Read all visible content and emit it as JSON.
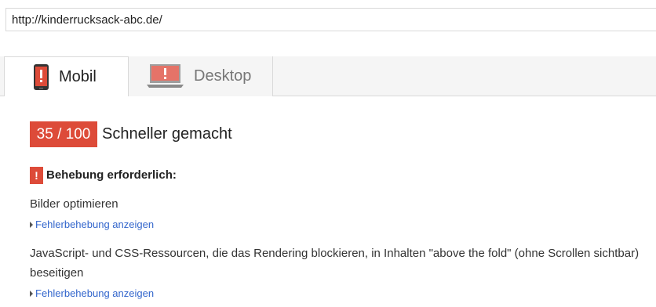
{
  "url_bar": {
    "value": "http://kinderrucksack-abc.de/"
  },
  "tabs": [
    {
      "label": "Mobil",
      "icon": "phone-icon",
      "selected": true
    },
    {
      "label": "Desktop",
      "icon": "monitor-icon",
      "selected": false
    }
  ],
  "score": {
    "value": "35 / 100",
    "title": "Schneller gemacht"
  },
  "status": {
    "label": "Behebung erforderlich:",
    "icon_glyph": "!"
  },
  "rules": [
    {
      "title": "Bilder optimieren",
      "link": "Fehlerbehebung anzeigen"
    },
    {
      "title": "JavaScript- und CSS-Ressourcen, die das Rendering blockieren, in Inhalten \"above the fold\" (ohne Scrollen sichtbar) beseitigen",
      "link": "Fehlerbehebung anzeigen"
    }
  ],
  "colors": {
    "alert_red": "#dd4b39",
    "link_blue": "#3366cc",
    "tab_inactive_bg": "#f5f5f5"
  }
}
